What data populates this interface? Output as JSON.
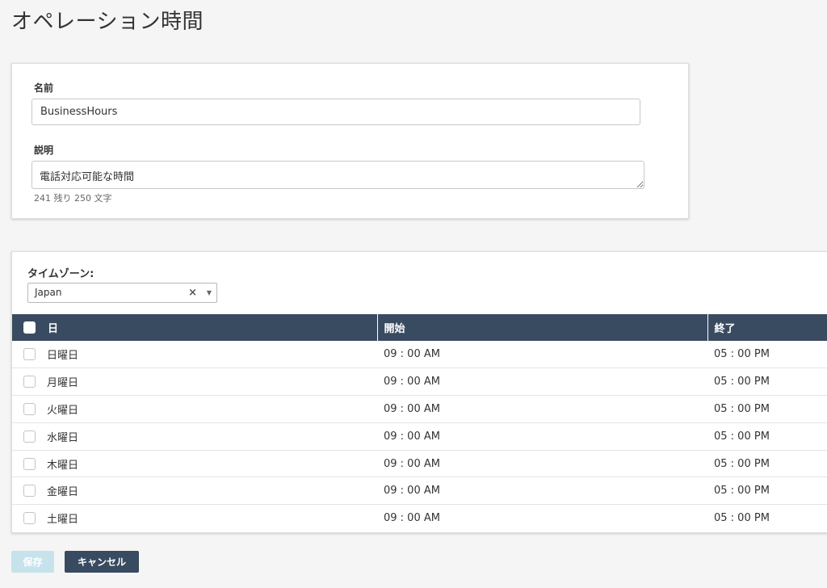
{
  "page": {
    "title": "オペレーション時間"
  },
  "info": {
    "name_label": "名前",
    "name_value": "BusinessHours",
    "description_label": "説明",
    "description_value": "電話対応可能な時間",
    "char_count": "241 残り 250 文字"
  },
  "timezone": {
    "label": "タイムゾーン:",
    "selected": "Japan",
    "clear_icon": "×",
    "arrow_icon": "▼"
  },
  "table": {
    "headers": {
      "day": "日",
      "start": "開始",
      "end": "終了"
    },
    "rows": [
      {
        "day": "日曜日",
        "start": "09 : 00 AM",
        "end": "05 : 00 PM"
      },
      {
        "day": "月曜日",
        "start": "09 : 00 AM",
        "end": "05 : 00 PM"
      },
      {
        "day": "火曜日",
        "start": "09 : 00 AM",
        "end": "05 : 00 PM"
      },
      {
        "day": "水曜日",
        "start": "09 : 00 AM",
        "end": "05 : 00 PM"
      },
      {
        "day": "木曜日",
        "start": "09 : 00 AM",
        "end": "05 : 00 PM"
      },
      {
        "day": "金曜日",
        "start": "09 : 00 AM",
        "end": "05 : 00 PM"
      },
      {
        "day": "土曜日",
        "start": "09 : 00 AM",
        "end": "05 : 00 PM"
      }
    ]
  },
  "actions": {
    "save_label": "保存",
    "cancel_label": "キャンセル"
  },
  "colors": {
    "header_bg": "#394b60",
    "save_disabled_bg": "#c6e3ec",
    "cancel_bg": "#394b60"
  }
}
